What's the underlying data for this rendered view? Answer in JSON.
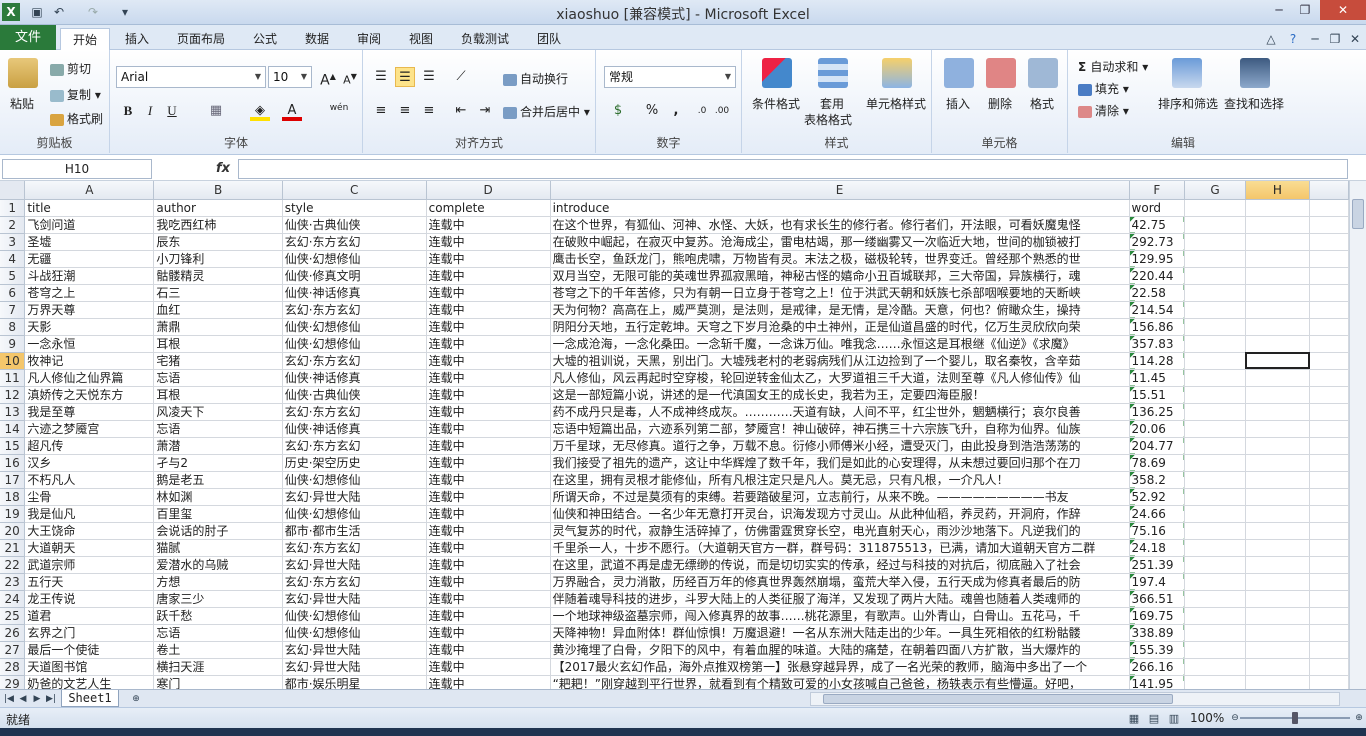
{
  "window": {
    "title": "xiaoshuo  [兼容模式] - Microsoft Excel"
  },
  "ribbon_tabs": [
    "文件",
    "开始",
    "插入",
    "页面布局",
    "公式",
    "数据",
    "审阅",
    "视图",
    "负载测试",
    "团队"
  ],
  "clipboard": {
    "paste": "粘贴",
    "cut": "剪切",
    "copy": "复制",
    "painter": "格式刷",
    "label": "剪贴板"
  },
  "font": {
    "name": "Arial",
    "size": "10",
    "label": "字体",
    "bold": "B",
    "italic": "I",
    "underline": "U",
    "wen": "wén"
  },
  "alignment": {
    "wrap": "自动换行",
    "merge": "合并后居中",
    "label": "对齐方式"
  },
  "number": {
    "format": "常规",
    "label": "数字",
    "percent": "%",
    "comma": ","
  },
  "styles": {
    "conditional": "条件格式",
    "table_fmt_1": "套用",
    "table_fmt_2": "表格格式",
    "cell_styles": "单元格样式",
    "label": "样式"
  },
  "cells": {
    "insert": "插入",
    "delete": "删除",
    "format": "格式",
    "label": "单元格"
  },
  "editing": {
    "autosum": "自动求和",
    "fill": "填充",
    "clear": "清除",
    "sort": "排序和筛选",
    "find": "查找和选择",
    "label": "编辑"
  },
  "formula_bar": {
    "name_box": "H10",
    "fx": "fx",
    "value": ""
  },
  "columns": [
    "A",
    "B",
    "C",
    "D",
    "E",
    "F",
    "G",
    "H"
  ],
  "rows": [
    [
      "title",
      "author",
      "style",
      "complete",
      "introduce",
      "word"
    ],
    [
      "飞剑问道",
      "我吃西红柿",
      "仙侠·古典仙侠",
      "连载中",
      "在这个世界，有狐仙、河神、水怪、大妖，也有求长生的修行者。修行者们，开法眼，可看妖魔鬼怪",
      "42.75"
    ],
    [
      "圣墟",
      "辰东",
      "玄幻·东方玄幻",
      "连载中",
      "在破败中崛起，在寂灭中复苏。沧海成尘，雷电枯竭，那一缕幽雾又一次临近大地，世间的枷锁被打",
      "292.73"
    ],
    [
      "无疆",
      "小刀锋利",
      "仙侠·幻想修仙",
      "连载中",
      "鹰击长空，鱼跃龙门，熊咆虎啸，万物皆有灵。末法之极，磁极轮转，世界变迁。曾经那个熟悉的世",
      "129.95"
    ],
    [
      "斗战狂潮",
      "骷髅精灵",
      "仙侠·修真文明",
      "连载中",
      "双月当空，无限可能的英魂世界孤寂黑暗，神秘古怪的嬉命小丑百城联邦，三大帝国，异族横行，魂",
      "220.44"
    ],
    [
      "苍穹之上",
      "石三",
      "仙侠·神话修真",
      "连载中",
      "苍穹之下的千年苦修，只为有朝一日立身于苍穹之上！位于洪武天朝和妖族七杀部咽喉要地的天断峡",
      "22.58"
    ],
    [
      "万界天尊",
      "血红",
      "玄幻·东方玄幻",
      "连载中",
      "天为何物？高高在上，威严莫测，是法则，是戒律，是无情，是冷酷。天意，何也？俯瞰众生，操持",
      "214.54"
    ],
    [
      "天影",
      "萧鼎",
      "仙侠·幻想修仙",
      "连载中",
      "阴阳分天地，五行定乾坤。天穹之下岁月沧桑的中土神州，正是仙道昌盛的时代，亿万生灵欣欣向荣",
      "156.86"
    ],
    [
      "一念永恒",
      "耳根",
      "仙侠·幻想修仙",
      "连载中",
      "一念成沧海，一念化桑田。一念斩千魔，一念诛万仙。唯我念……永恒这是耳根继《仙逆》《求魔》",
      "357.83"
    ],
    [
      "牧神记",
      "宅猪",
      "玄幻·东方玄幻",
      "连载中",
      "大墟的祖训说，天黑，别出门。大墟残老村的老弱病残们从江边捡到了一个婴儿，取名秦牧，含辛茹",
      "114.28"
    ],
    [
      "凡人修仙之仙界篇",
      "忘语",
      "仙侠·神话修真",
      "连载中",
      "凡人修仙，风云再起时空穿梭，轮回逆转金仙太乙，大罗道祖三千大道，法则至尊《凡人修仙传》仙",
      "11.45"
    ],
    [
      "滇娇传之天悦东方",
      "耳根",
      "仙侠·古典仙侠",
      "连载中",
      "这是一部短篇小说，讲述的是一代滇国女王的成长史，我若为王，定要四海臣服！",
      "15.51"
    ],
    [
      "我是至尊",
      "风凌天下",
      "玄幻·东方玄幻",
      "连载中",
      "药不成丹只是毒，人不成神终成灰。…………天道有缺，人间不平，红尘世外，魍魉横行；哀尔良善",
      "136.25"
    ],
    [
      "六迹之梦魇宫",
      "忘语",
      "仙侠·神话修真",
      "连载中",
      "忘语中短篇出品，六迹系列第二部，梦魇宫！神山破碎，神石携三十六宗族飞升，自称为仙界。仙族",
      "20.06"
    ],
    [
      "超凡传",
      "萧潜",
      "玄幻·东方玄幻",
      "连载中",
      "万千星球，无尽修真。道行之争，万载不息。衍修小师傅米小经，遭受灭门，由此投身到浩浩荡荡的",
      "204.77"
    ],
    [
      "汉乡",
      "孑与2",
      "历史·架空历史",
      "连载中",
      "我们接受了祖先的遗产，这让中华辉煌了数千年，我们是如此的心安理得，从未想过要回归那个在刀",
      "78.69"
    ],
    [
      "不朽凡人",
      "鹅是老五",
      "仙侠·幻想修仙",
      "连载中",
      "在这里，拥有灵根才能修仙，所有凡根注定只是凡人。莫无忌，只有凡根，一介凡人！",
      "358.2"
    ],
    [
      "尘骨",
      "林如渊",
      "玄幻·异世大陆",
      "连载中",
      "所谓天命，不过是莫须有的束缚。若要踏破星河，立志前行，从来不晚。—————————书友",
      "52.92"
    ],
    [
      "我是仙凡",
      "百里玺",
      "仙侠·幻想修仙",
      "连载中",
      "仙侠和神田结合。一名少年无意打开灵台，识海发现方寸灵山。从此种仙稻，养灵药，开洞府，作辞",
      "24.66"
    ],
    [
      "大王饶命",
      "会说话的肘子",
      "都市·都市生活",
      "连载中",
      "灵气复苏的时代，寂静生活碎掉了，仿佛雷霆贯穿长空，电光直射天心，雨沙沙地落下。凡逆我们的",
      "75.16"
    ],
    [
      "大道朝天",
      "猫腻",
      "玄幻·东方玄幻",
      "连载中",
      "千里杀一人，十步不愿行。（大道朝天官方一群，群号码：311875513，已满，请加大道朝天官方二群",
      "24.18"
    ],
    [
      "武道宗师",
      "爱潜水的乌贼",
      "玄幻·异世大陆",
      "连载中",
      "在这里，武道不再是虚无缥缈的传说，而是切切实实的传承，经过与科技的对抗后，彻底融入了社会",
      "251.39"
    ],
    [
      "五行天",
      "方想",
      "玄幻·东方玄幻",
      "连载中",
      "万界融合，灵力消散，历经百万年的修真世界轰然崩塌，蛮荒大举入侵，五行天成为修真者最后的防",
      "197.4"
    ],
    [
      "龙王传说",
      "唐家三少",
      "玄幻·异世大陆",
      "连载中",
      "伴随着魂导科技的进步，斗罗大陆上的人类征服了海洋，又发现了两片大陆。魂兽也随着人类魂师的",
      "366.51"
    ],
    [
      "道君",
      "跃千愁",
      "仙侠·幻想修仙",
      "连载中",
      "一个地球神级盗墓宗师，闯入修真界的故事……桃花源里，有歌声。山外青山，白骨山。五花马，千",
      "169.75"
    ],
    [
      "玄界之门",
      "忘语",
      "仙侠·幻想修仙",
      "连载中",
      "天降神物！异血附体！群仙惊惧！万魔退避！一名从东洲大陆走出的少年。一具生死相依的红粉骷髅",
      "338.89"
    ],
    [
      "最后一个使徒",
      "卷土",
      "玄幻·异世大陆",
      "连载中",
      "黄沙掩埋了白骨，夕阳下的风中，有着血腥的味道。大陆的痛楚，在朝着四面八方扩散，当大爆炸的",
      "155.39"
    ],
    [
      "天道图书馆",
      "横扫天涯",
      "玄幻·异世大陆",
      "连载中",
      "【2017最火玄幻作品，海外点推双榜第一】张悬穿越异界，成了一名光荣的教师，脑海中多出了一个",
      "266.16"
    ],
    [
      "奶爸的文艺人生",
      "寒门",
      "都市·娱乐明星",
      "连载中",
      "“耙耙！”刚穿越到平行世界，就看到有个精致可爱的小女孩喊自己爸爸，杨轶表示有些懵逼。好吧，",
      "141.95"
    ]
  ],
  "sheet_tab": "Sheet1",
  "status": {
    "ready": "就绪",
    "zoom": "100%"
  }
}
